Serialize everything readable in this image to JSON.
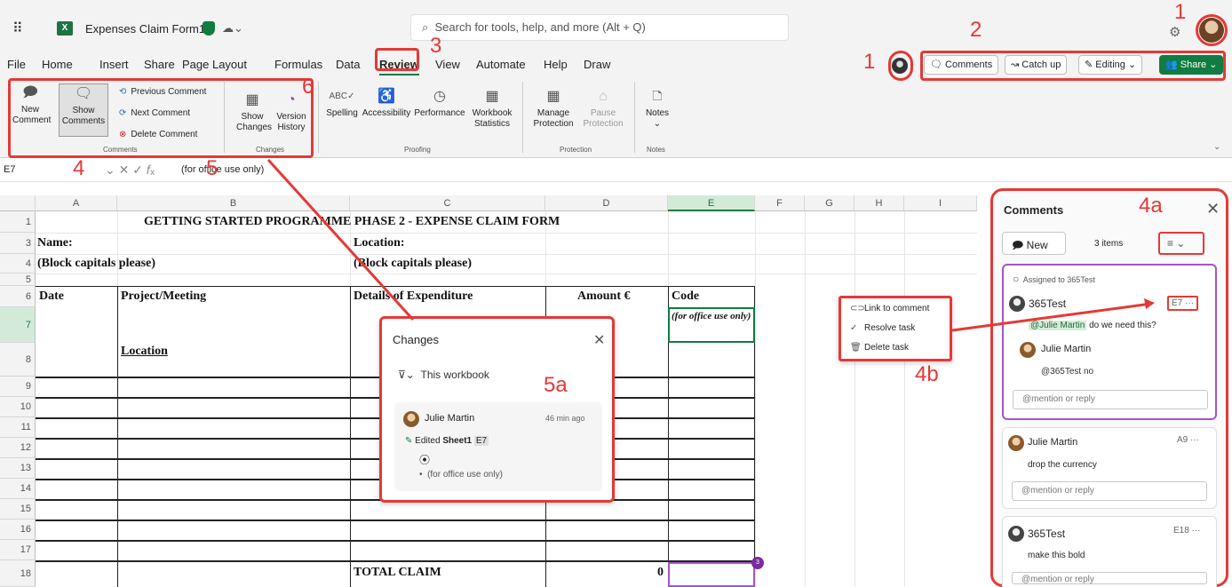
{
  "app": {
    "doc_title": "Expenses Claim Form1",
    "search_placeholder": "Search for tools, help, and more (Alt + Q)",
    "waffle": "⠿",
    "xl_icon": "X"
  },
  "menu": [
    "File",
    "Home",
    "Insert",
    "Share",
    "Page Layout",
    "Formulas",
    "Data",
    "Review",
    "View",
    "Automate",
    "Help",
    "Draw"
  ],
  "header_buttons": {
    "comments": "Comments",
    "catchup": "Catch up",
    "editing": "Editing",
    "share": "Share"
  },
  "ribbon": {
    "new_comment": "New Comment",
    "show_comments": "Show Comments",
    "previous_comment": "Previous Comment",
    "next_comment": "Next Comment",
    "delete_comment": "Delete Comment",
    "group_comments": "Comments",
    "show_changes": "Show Changes",
    "version_history": "Version History",
    "group_changes": "Changes",
    "spelling": "Spelling",
    "accessibility": "Accessibility",
    "performance": "Performance",
    "workbook_statistics": "Workbook Statistics",
    "group_proofing": "Proofing",
    "manage_protection": "Manage Protection",
    "pause_protection": "Pause Protection",
    "group_protection": "Protection",
    "notes": "Notes",
    "group_notes": "Notes"
  },
  "formula_bar": {
    "name_box": "E7",
    "formula": "(for office use only)"
  },
  "columns": [
    "A",
    "B",
    "C",
    "D",
    "E",
    "F",
    "G",
    "H",
    "I"
  ],
  "rows": [
    "1",
    "3",
    "4",
    "5",
    "6",
    "7",
    "8",
    "9",
    "10",
    "11",
    "12",
    "13",
    "14",
    "15",
    "16",
    "17",
    "18"
  ],
  "sheet": {
    "title": "GETTING STARTED PROGRAMME PHASE 2 - EXPENSE CLAIM FORM",
    "name_label": "Name:",
    "location_label": "Location:",
    "block_caps_1": "(Block capitals please)",
    "block_caps_2": "(Block capitals please)",
    "date_hdr": "Date",
    "project_hdr": "Project/Meeting",
    "details_hdr": "Details of Expenditure",
    "amount_hdr": "Amount €",
    "code_hdr": "Code",
    "office_use": "(for office use only)",
    "location_sub": "Location",
    "total_claim": "TOTAL CLAIM",
    "total_value": "0",
    "comment_count": "3"
  },
  "changes_pane": {
    "title": "Changes",
    "filter": "This workbook",
    "user": "Julie Martin",
    "time": "46 min ago",
    "action": "Edited",
    "sheet": "Sheet1",
    "cell": "E7",
    "value": "(for office use only)"
  },
  "context_menu": [
    "Link to comment",
    "Resolve task",
    "Delete task"
  ],
  "comments_pane": {
    "title": "Comments",
    "new_label": "New",
    "count": "3 items",
    "assigned": "Assigned to 365Test",
    "threads": [
      {
        "author": "365Test",
        "ref": "E7",
        "mention": "@Julie Martin",
        "text": "do we need this?",
        "reply_author": "Julie Martin",
        "reply_mention": "@365Test",
        "reply_text": "no",
        "reply_placeholder": "@mention or reply"
      },
      {
        "author": "Julie Martin",
        "ref": "A9",
        "text": "drop the currency",
        "reply_placeholder": "@mention or reply"
      },
      {
        "author": "365Test",
        "ref": "E18",
        "text": "make this bold",
        "reply_placeholder": "@mention or reply"
      }
    ]
  },
  "callouts": {
    "c1": "1",
    "c1b": "1",
    "c2": "2",
    "c3": "3",
    "c4": "4",
    "c4a": "4a",
    "c4b": "4b",
    "c5": "5",
    "c5a": "5a",
    "c6": "6"
  },
  "colors": {
    "accent": "#107c41",
    "annotation": "#e53935",
    "comment_purple": "#a455c9"
  }
}
